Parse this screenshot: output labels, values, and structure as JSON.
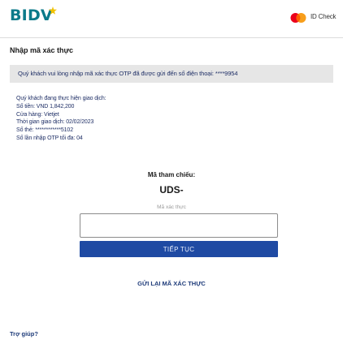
{
  "header": {
    "logo_text": "BIDV",
    "logo_mark": "star-icon",
    "card_scheme_icon": "mastercard-icon",
    "id_check_label": "ID Check"
  },
  "form": {
    "title": "Nhập mã xác thực",
    "instruction": "Quý khách vui lòng nhập mã xác thực OTP đã được gửi đến số điện thoại: ****9954",
    "transaction": {
      "intro": "Quý khách đang thực hiện giao dịch:",
      "amount": "Số tiền: VND 1,842,200",
      "merchant": "Cửa hàng: Vietjet",
      "time": "Thời gian giao dịch: 02/02/2023",
      "card_number": "Số thẻ: ************5102",
      "attempts_left": "Số lần nhập OTP tối đa: 04"
    },
    "reference_label": "Mã tham chiếu:",
    "reference_value": "UDS-",
    "code_label": "Mã xác thực",
    "code_value": "",
    "continue_label": "TIẾP TỤC",
    "resend_label": "GỬI LẠI MÃ XÁC THỰC"
  },
  "footer": {
    "help_label": "Trợ giúp?"
  },
  "colors": {
    "brand_teal": "#0b7a8a",
    "star_yellow": "#f2c200",
    "button_blue": "#1f4aa3",
    "link_blue": "#1f3c7a",
    "info_bg": "#e6e6e6",
    "mastercard_red": "#eb001b",
    "mastercard_orange": "#f79e1b"
  }
}
